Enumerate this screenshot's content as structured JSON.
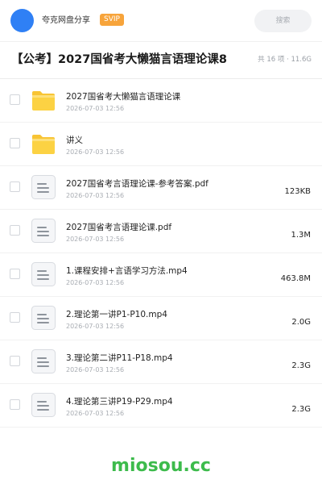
{
  "header": {
    "username": "夸克网盘分享",
    "badge": "SVIP",
    "search_label": "搜索",
    "avatar_color": "#2f80f5",
    "badge_color": "#f7a43b"
  },
  "folder": {
    "title": "【公考】2027国省考大懒猫言语理论课8",
    "meta": "共 16 项 · 11.6G"
  },
  "files": [
    {
      "name": "2027国省考大懒猫言语理论课",
      "date": "2026-07-03 12:56",
      "size": "",
      "icon": "folder-icon"
    },
    {
      "name": "讲义",
      "date": "2026-07-03 12:56",
      "size": "",
      "icon": "folder-icon"
    },
    {
      "name": "2027国省考言语理论课-参考答案.pdf",
      "date": "2026-07-03 12:56",
      "size": "123KB",
      "icon": "document-icon"
    },
    {
      "name": "2027国省考言语理论课.pdf",
      "date": "2026-07-03 12:56",
      "size": "1.3M",
      "icon": "document-icon"
    },
    {
      "name": "1.课程安排+言语学习方法.mp4",
      "date": "2026-07-03 12:56",
      "size": "463.8M",
      "icon": "document-icon"
    },
    {
      "name": "2.理论第一讲P1-P10.mp4",
      "date": "2026-07-03 12:56",
      "size": "2.0G",
      "icon": "document-icon"
    },
    {
      "name": "3.理论第二讲P11-P18.mp4",
      "date": "2026-07-03 12:56",
      "size": "2.3G",
      "icon": "document-icon"
    },
    {
      "name": "4.理论第三讲P19-P29.mp4",
      "date": "2026-07-03 12:56",
      "size": "2.3G",
      "icon": "document-icon"
    }
  ],
  "watermark": {
    "text": "miosou.cc",
    "color": "#3dbb4c"
  }
}
